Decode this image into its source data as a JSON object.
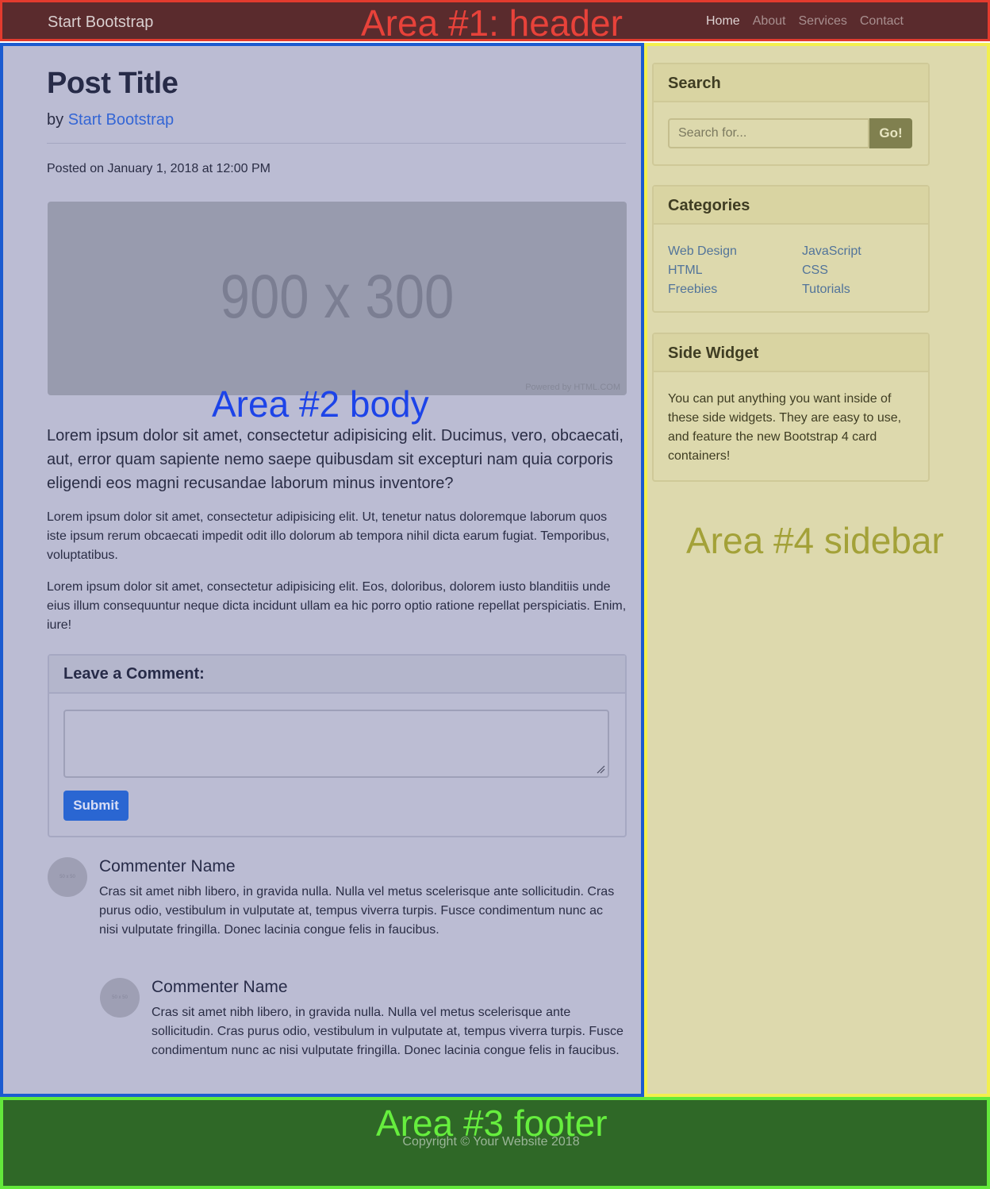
{
  "header": {
    "brand": "Start Bootstrap",
    "area_label": "Area #1: header",
    "nav": [
      "Home",
      "About",
      "Services",
      "Contact"
    ]
  },
  "body": {
    "area_label": "Area #2 body",
    "post_title": "Post Title",
    "byline_prefix": "by ",
    "author": "Start Bootstrap",
    "posted": "Posted on January 1, 2018 at 12:00 PM",
    "hero_placeholder": "900 x 300",
    "hero_powered": "Powered by HTML.COM",
    "lead": "Lorem ipsum dolor sit amet, consectetur adipisicing elit. Ducimus, vero, obcaecati, aut, error quam sapiente nemo saepe quibusdam sit excepturi nam quia corporis eligendi eos magni recusandae laborum minus inventore?",
    "paragraphs": [
      "Lorem ipsum dolor sit amet, consectetur adipisicing elit. Ut, tenetur natus doloremque laborum quos iste ipsum rerum obcaecati impedit odit illo dolorum ab tempora nihil dicta earum fugiat. Temporibus, voluptatibus.",
      "Lorem ipsum dolor sit amet, consectetur adipisicing elit. Eos, doloribus, dolorem iusto blanditiis unde eius illum consequuntur neque dicta incidunt ullam ea hic porro optio ratione repellat perspiciatis. Enim, iure!"
    ],
    "comment_form": {
      "heading": "Leave a Comment:",
      "submit_label": "Submit"
    },
    "comments": [
      {
        "avatar_text": "50 x 50",
        "name": "Commenter Name",
        "text": "Cras sit amet nibh libero, in gravida nulla. Nulla vel metus scelerisque ante sollicitudin. Cras purus odio, vestibulum in vulputate at, tempus viverra turpis. Fusce condimentum nunc ac nisi vulputate fringilla. Donec lacinia congue felis in faucibus."
      },
      {
        "avatar_text": "50 x 50",
        "name": "Commenter Name",
        "text": "Cras sit amet nibh libero, in gravida nulla. Nulla vel metus scelerisque ante sollicitudin. Cras purus odio, vestibulum in vulputate at, tempus viverra turpis. Fusce condimentum nunc ac nisi vulputate fringilla. Donec lacinia congue felis in faucibus."
      }
    ]
  },
  "sidebar": {
    "area_label": "Area #4 sidebar",
    "search": {
      "heading": "Search",
      "placeholder": "Search for...",
      "button": "Go!"
    },
    "categories": {
      "heading": "Categories",
      "items": [
        "Web Design",
        "JavaScript",
        "HTML",
        "CSS",
        "Freebies",
        "Tutorials"
      ]
    },
    "side_widget": {
      "heading": "Side Widget",
      "text": "You can put anything you want inside of these side widgets. They are easy to use, and feature the new Bootstrap 4 card containers!"
    }
  },
  "footer": {
    "area_label": "Area #3 footer",
    "copyright": "Copyright © Your Website 2018"
  },
  "colors": {
    "header_overlay": "#e23b2e",
    "body_overlay": "#1b5bd0",
    "footer_overlay": "#63e83b",
    "sidebar_overlay": "#f3ef4e",
    "link": "#3466d5",
    "primary_button": "#2a66d2"
  }
}
